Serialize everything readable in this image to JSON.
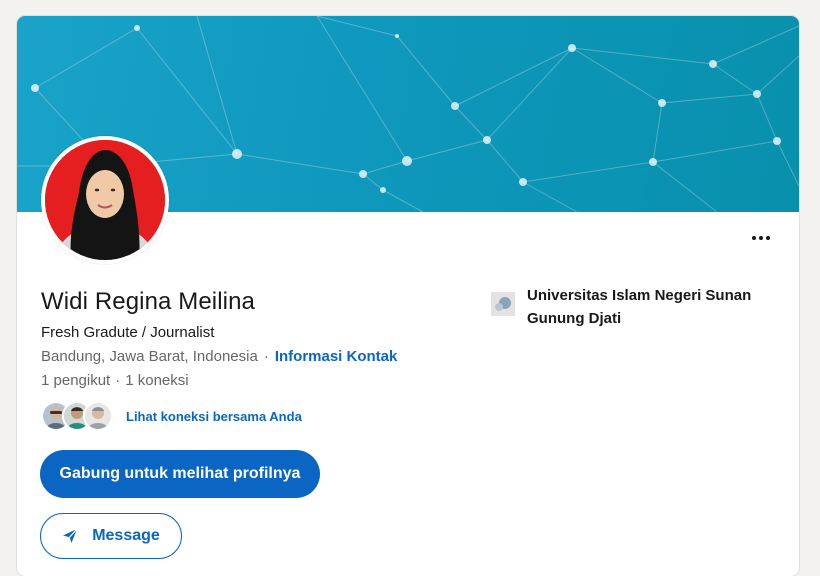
{
  "profile": {
    "name": "Widi Regina Meilina",
    "headline": "Fresh Gradute / Journalist",
    "location": "Bandung, Jawa Barat, Indonesia",
    "location_separator": "·",
    "contact_link": "Informasi Kontak",
    "followers": "1 pengikut",
    "stats_separator": "·",
    "connections": "1 koneksi"
  },
  "shared_connections": {
    "link_label": "Lihat koneksi bersama Anda",
    "avatars": [
      "avatar-man-glasses",
      "avatar-man-teal-shirt",
      "avatar-man-grey"
    ]
  },
  "actions": {
    "join_label": "Gabung untuk melihat profilnya",
    "message_label": "Message",
    "more_icon": "more-horizontal-icon"
  },
  "education": {
    "school": "Universitas Islam Negeri Sunan Gunung Djati"
  },
  "colors": {
    "brand_blue": "#0a66c2",
    "banner_teal": "#0f98bd",
    "avatar_bg_red": "#e51f1f"
  }
}
